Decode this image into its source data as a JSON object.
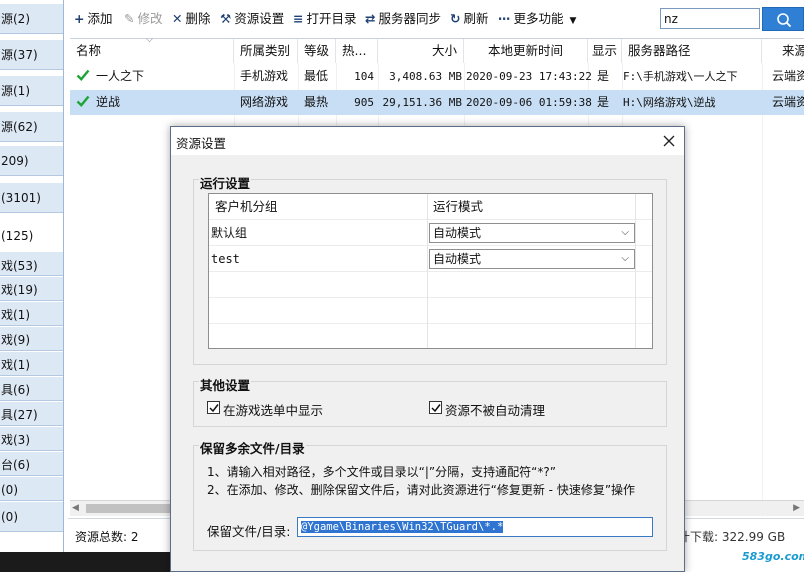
{
  "left_categories": [
    {
      "label": "源(2)"
    },
    {
      "label": "源(37)"
    },
    {
      "label": "源(1)"
    },
    {
      "label": "源(62)"
    },
    {
      "label": "209)"
    },
    {
      "label": "(3101)"
    },
    {
      "label": "(125)",
      "selected": true
    },
    {
      "label": "戏(53)"
    },
    {
      "label": "戏(19)"
    },
    {
      "label": "戏(1)"
    },
    {
      "label": "戏(9)"
    },
    {
      "label": "戏(1)"
    },
    {
      "label": "具(6)"
    },
    {
      "label": "具(27)"
    },
    {
      "label": "戏(3)"
    },
    {
      "label": "台(6)"
    },
    {
      "label": "(0)"
    },
    {
      "label": "(0)"
    }
  ],
  "toolbar": {
    "add": "添加",
    "edit": "修改",
    "delete": "删除",
    "resource_settings": "资源设置",
    "open_dir": "打开目录",
    "server_sync": "服务器同步",
    "refresh": "刷新",
    "more": "更多功能",
    "search_value": "nz"
  },
  "table": {
    "headers": {
      "name": "名称",
      "category": "所属类别",
      "level": "等级",
      "heat": "热...",
      "size": "大小",
      "local_time": "本地更新时间",
      "show": "显示",
      "server_path": "服务器路径",
      "source": "来源"
    },
    "rows": [
      {
        "name": "一人之下",
        "category": "手机游戏",
        "level": "最低",
        "heat": "104",
        "size": "3,408.63 MB",
        "local_time": "2020-09-23 17:43:22",
        "show": "是",
        "server_path": "F:\\手机游戏\\一人之下",
        "source": "云端资"
      },
      {
        "name": "逆战",
        "category": "网络游戏",
        "level": "最热",
        "heat": "905",
        "size": "29,151.36 MB",
        "local_time": "2020-09-06 01:59:38",
        "show": "是",
        "server_path": "H:\\网络游戏\\逆战",
        "source": "云端资"
      }
    ]
  },
  "status": {
    "total": "资源总数: 2",
    "download": "计下载: 322.99 GB"
  },
  "watermark": "583go.com",
  "dialog": {
    "title": "资源设置",
    "run_settings": {
      "title": "运行设置",
      "col_group": "客户机分组",
      "col_mode": "运行模式",
      "rows": [
        {
          "group": "默认组",
          "mode": "自动模式"
        },
        {
          "group": "test",
          "mode": "自动模式"
        }
      ]
    },
    "other_settings": {
      "title": "其他设置",
      "show_in_menu": {
        "label": "在游戏选单中显示",
        "checked": true
      },
      "no_auto_clean": {
        "label": "资源不被自动清理",
        "checked": true
      }
    },
    "keep_files": {
      "title": "保留多余文件/目录",
      "note1": "1、请输入相对路径，多个文件或目录以“|”分隔，支持通配符“*?”",
      "note2": "2、在添加、修改、删除保留文件后，请对此资源进行“修复更新 - 快速修复”操作",
      "label": "保留文件/目录:",
      "value": "@Ygame\\Binaries\\Win32\\TGuard\\*.*"
    }
  }
}
